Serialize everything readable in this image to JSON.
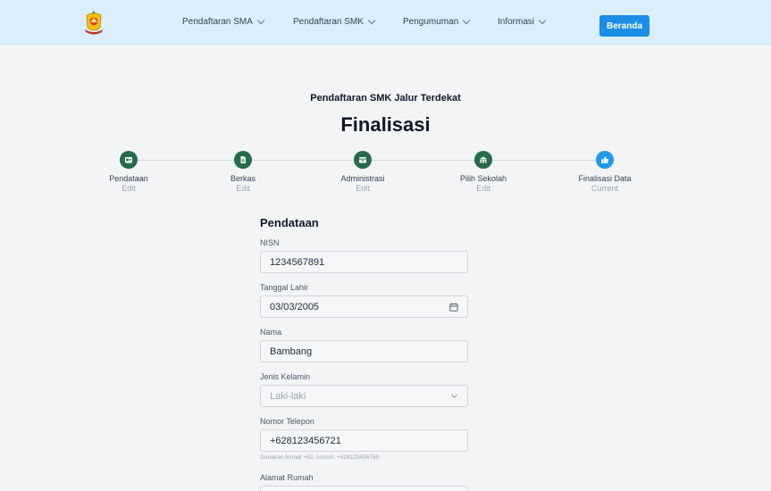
{
  "nav": {
    "items": [
      {
        "label": "Pendaftaran SMA"
      },
      {
        "label": "Pendaftaran SMK"
      },
      {
        "label": "Pengumuman"
      },
      {
        "label": "Informasi"
      }
    ],
    "home_button": "Beranda"
  },
  "page": {
    "subtitle": "Pendaftaran SMK Jalur Terdekat",
    "title": "Finalisasi"
  },
  "steps": [
    {
      "label": "Pendataan",
      "status": "Edit",
      "icon": "id-card-icon",
      "state": "done"
    },
    {
      "label": "Berkas",
      "status": "Edit",
      "icon": "document-icon",
      "state": "done"
    },
    {
      "label": "Administrasi",
      "status": "Edit",
      "icon": "wallet-icon",
      "state": "done"
    },
    {
      "label": "Pilih Sekolah",
      "status": "Edit",
      "icon": "school-icon",
      "state": "done"
    },
    {
      "label": "Finalisasi Data",
      "status": "Current",
      "icon": "thumbs-up-icon",
      "state": "current"
    }
  ],
  "colors": {
    "nav_bg": "#dbeefc",
    "accent": "#1a8ee4",
    "step_done": "#256b4c",
    "step_current": "#1e9ae6"
  },
  "form": {
    "heading": "Pendataan",
    "nisn": {
      "label": "NISN",
      "value": "1234567891"
    },
    "tanggal_lahir": {
      "label": "Tanggal Lahir",
      "value": "03/03/2005"
    },
    "nama": {
      "label": "Nama",
      "value": "Bambang"
    },
    "jenis_kelamin": {
      "label": "Jenis Kelamin",
      "value": "Laki-laki"
    },
    "nomor_telepon": {
      "label": "Nomor Telepon",
      "value": "+628123456721",
      "hint": "Gunakan format +62, contoh: +628123456789"
    },
    "alamat_rumah": {
      "label": "Alamat Rumah",
      "value": ""
    }
  }
}
